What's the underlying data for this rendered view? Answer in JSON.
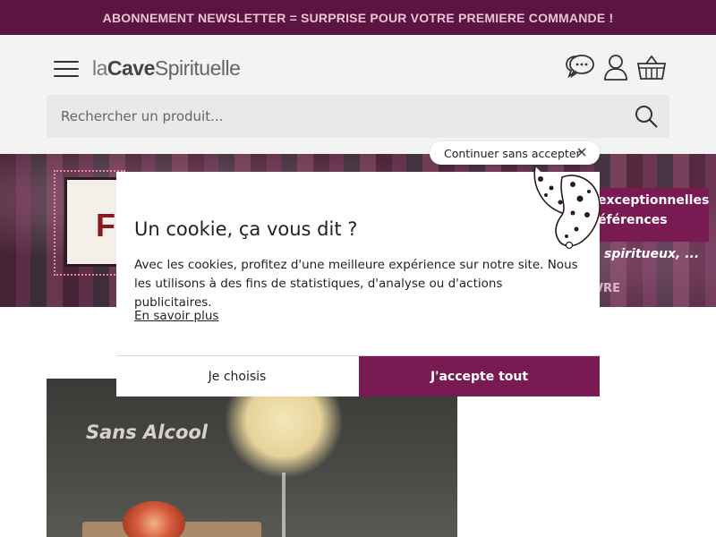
{
  "top_banner": {
    "text": "ABONNEMENT NEWSLETTER = SURPRISE POUR VOTRE PREMIERE COMMANDE !"
  },
  "header": {
    "logo": {
      "part1": "la",
      "part2": "Cave",
      "part3": "Spirituelle"
    },
    "icons": [
      "menu-icon",
      "chat-icon",
      "user-icon",
      "basket-icon"
    ]
  },
  "search": {
    "placeholder": "Rechercher un produit..."
  },
  "hero": {
    "letter": "F",
    "line1": "exceptionnelles",
    "line2": "éférences",
    "line3": "spiritueux, ...",
    "line4": "VRE"
  },
  "product_card": {
    "label": "Sans Alcool"
  },
  "cookie_modal": {
    "continue_label": "Continuer sans accepter",
    "title": "Un cookie, ça vous dit ?",
    "body": "Avec les cookies, profitez d'une meilleure expérience sur notre site. Nous les utilisons à des fins de statistiques, d'analyse ou d'actions publicitaires.",
    "link": "En savoir plus",
    "choose_button": "Je choisis",
    "accept_button": "J'accepte tout"
  },
  "colors": {
    "brand": "#7a1a52",
    "banner_bg": "#5a1542",
    "header_bg": "#f3f3f3"
  }
}
